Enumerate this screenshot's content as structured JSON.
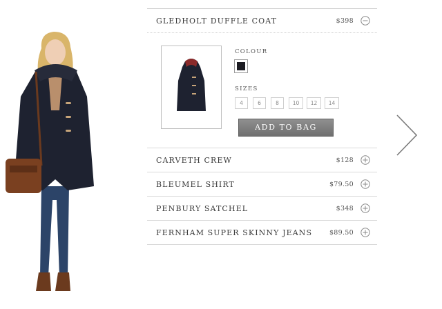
{
  "products": [
    {
      "name": "GLEDHOLT DUFFLE COAT",
      "price": "$398",
      "toggle_icon": "minus-circle-icon",
      "expanded": true
    },
    {
      "name": "CARVETH CREW",
      "price": "$128",
      "toggle_icon": "plus-circle-icon"
    },
    {
      "name": "BLEUMEL SHIRT",
      "price": "$79.50",
      "toggle_icon": "plus-circle-icon"
    },
    {
      "name": "PENBURY SATCHEL",
      "price": "$348",
      "toggle_icon": "plus-circle-icon"
    },
    {
      "name": "FERNHAM SUPER SKINNY JEANS",
      "price": "$89.50",
      "toggle_icon": "plus-circle-icon"
    }
  ],
  "detail": {
    "colour_label": "COLOUR",
    "colour_swatch": "#1c1c22",
    "sizes_label": "SIZES",
    "sizes": [
      "4",
      "6",
      "8",
      "10",
      "12",
      "14"
    ],
    "add_to_bag": "ADD TO BAG"
  },
  "navigation": {
    "next_icon": "chevron-right-icon"
  },
  "colors": {
    "coat": "#1e2230",
    "divider": "#d9d9d9",
    "button": "#7d7d7d"
  }
}
